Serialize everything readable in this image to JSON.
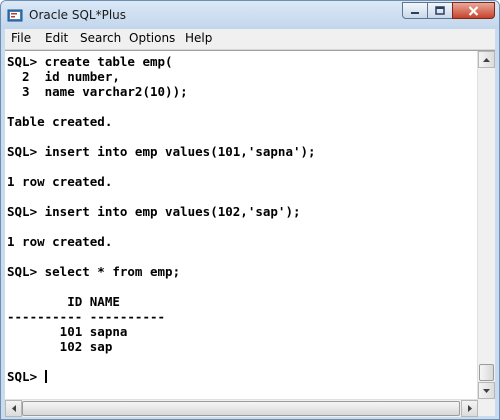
{
  "window": {
    "title": "Oracle SQL*Plus",
    "icon": "sqlplus-app-icon"
  },
  "menu": [
    "File",
    "Edit",
    "Search",
    "Options",
    "Help"
  ],
  "console": {
    "lines": [
      "SQL> create table emp(",
      "  2  id number,",
      "  3  name varchar2(10));",
      "",
      "Table created.",
      "",
      "SQL> insert into emp values(101,'sapna');",
      "",
      "1 row created.",
      "",
      "SQL> insert into emp values(102,'sap');",
      "",
      "1 row created.",
      "",
      "SQL> select * from emp;",
      "",
      "        ID NAME",
      "---------- ----------",
      "       101 sapna",
      "       102 sap",
      "",
      "SQL> "
    ]
  }
}
